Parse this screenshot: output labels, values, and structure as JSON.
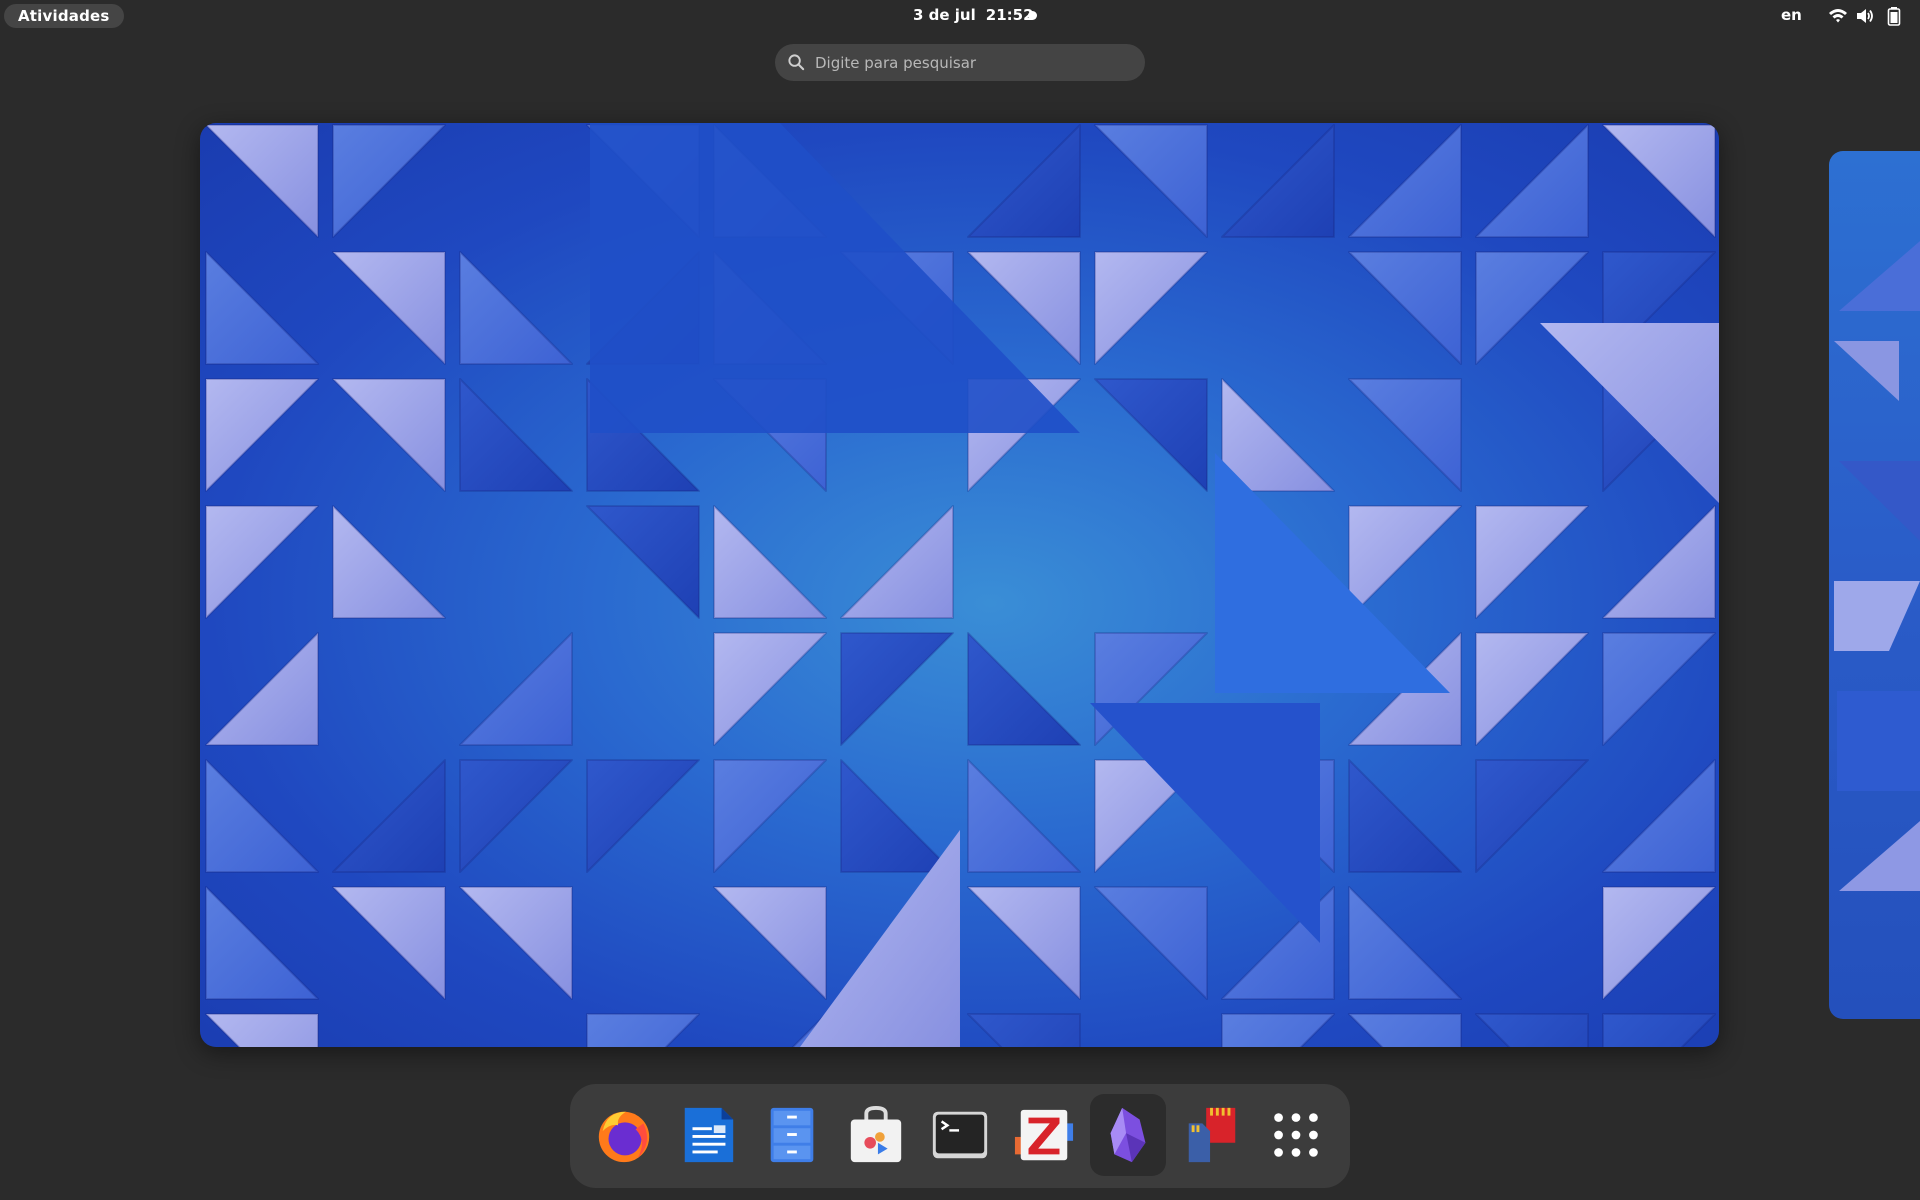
{
  "topbar": {
    "activities_label": "Atividades",
    "clock_date": "3 de jul",
    "clock_time": "21:52",
    "input_language": "en",
    "status_icons": [
      "wifi-icon",
      "volume-icon",
      "battery-icon"
    ]
  },
  "search": {
    "placeholder": "Digite para pesquisar",
    "value": ""
  },
  "workspaces": {
    "current_wallpaper": "blue-triangles",
    "accent_colors": [
      "#1f48c0",
      "#3a8ed6",
      "#8f9be6"
    ]
  },
  "dock": {
    "items": [
      {
        "app": "Firefox",
        "icon": "firefox-icon"
      },
      {
        "app": "Writer",
        "icon": "writer-icon"
      },
      {
        "app": "Files",
        "icon": "file-cabinet-icon"
      },
      {
        "app": "Software",
        "icon": "software-store-icon"
      },
      {
        "app": "Terminal",
        "icon": "terminal-icon"
      },
      {
        "app": "Zotero",
        "icon": "zotero-icon"
      },
      {
        "app": "Obsidian",
        "icon": "obsidian-icon"
      },
      {
        "app": "SD Card Utility",
        "icon": "sd-cards-icon"
      },
      {
        "app": "Show Apps",
        "icon": "app-grid-icon"
      }
    ]
  }
}
